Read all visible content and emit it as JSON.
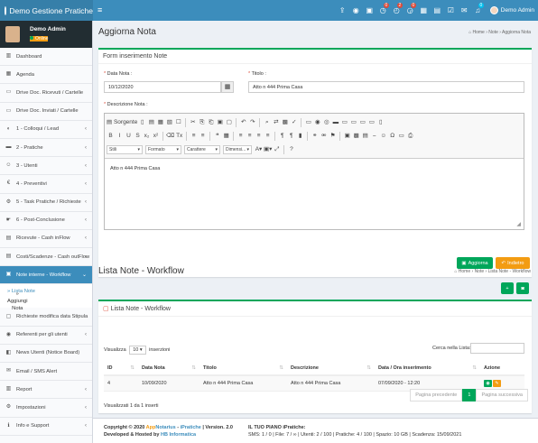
{
  "app": {
    "title": "Demo Gestione Pratiche"
  },
  "topbar": {
    "user_name": "Demo Admin",
    "icons": [
      {
        "name": "upload-icon",
        "glyph": "⇪",
        "badge": ""
      },
      {
        "name": "eye-icon",
        "glyph": "◉",
        "badge": ""
      },
      {
        "name": "warning-icon",
        "glyph": "▣",
        "badge": ""
      },
      {
        "name": "clock-icon",
        "glyph": "◷",
        "badge": "0"
      },
      {
        "name": "alarm-icon",
        "glyph": "◴",
        "badge": "2"
      },
      {
        "name": "stopwatch-icon",
        "glyph": "◶",
        "badge": "0"
      },
      {
        "name": "calendar-icon",
        "glyph": "▦",
        "badge": ""
      },
      {
        "name": "calendar-check-icon",
        "glyph": "▤",
        "badge": ""
      },
      {
        "name": "task-icon",
        "glyph": "☑",
        "badge": ""
      },
      {
        "name": "envelope-icon",
        "glyph": "✉",
        "badge": ""
      },
      {
        "name": "bell-icon",
        "glyph": "♫",
        "badge": "0"
      }
    ]
  },
  "sidebar": {
    "user": {
      "name": "Demo Admin",
      "status": "Online"
    },
    "items": [
      {
        "label": "Dashboard",
        "icon": "▥",
        "caret": ""
      },
      {
        "label": "Agenda",
        "icon": "▦",
        "caret": ""
      },
      {
        "label": "Drive Doc. Ricevuti / Cartelle",
        "icon": "▭",
        "caret": ""
      },
      {
        "label": "Drive Doc. Inviati / Cartelle",
        "icon": "▭",
        "caret": ""
      },
      {
        "label": "1 - Colloqui / Lead",
        "icon": "◐",
        "caret": "‹"
      },
      {
        "label": "2 - Pratiche",
        "icon": "▬",
        "caret": "‹"
      },
      {
        "label": "3 - Utenti",
        "icon": "☺",
        "caret": "‹"
      },
      {
        "label": "4 - Preventivi",
        "icon": "€",
        "caret": "‹"
      },
      {
        "label": "5 - Task Pratiche / Richieste",
        "icon": "⚙",
        "caret": "‹"
      },
      {
        "label": "6 - Post-Conclusione",
        "icon": "☛",
        "caret": "‹"
      },
      {
        "label": "Ricevute - Cash inFlow",
        "icon": "▤",
        "caret": "‹"
      },
      {
        "label": "Costi/Scadenze - Cash outFlow",
        "icon": "▤",
        "caret": "‹"
      },
      {
        "label": "Note interne - Workflow",
        "icon": "▣",
        "caret": "⌄"
      }
    ],
    "subitems": [
      "Lista Note",
      "Aggiungi Nota"
    ],
    "items_after": [
      {
        "label": "Richieste modifica data Stipula",
        "icon": "▢",
        "caret": ""
      },
      {
        "label": "Referenti per gli utenti",
        "icon": "◉",
        "caret": "‹"
      },
      {
        "label": "News Utenti (Notice Board)",
        "icon": "◧",
        "caret": ""
      },
      {
        "label": "Email / SMS Alert",
        "icon": "✉",
        "caret": ""
      },
      {
        "label": "Report",
        "icon": "▥",
        "caret": "‹"
      },
      {
        "label": "Impostazioni",
        "icon": "⚙",
        "caret": "‹"
      },
      {
        "label": "Info e Support",
        "icon": "ℹ",
        "caret": "‹"
      }
    ]
  },
  "section1": {
    "title": "Aggiorna Nota",
    "breadcrumb": [
      "Home",
      "Note",
      "Aggiorna Nota"
    ],
    "box_title": "Form inserimento Note",
    "date_label": "Data Nota :",
    "date_value": "10/12/2020",
    "title_label": "Titolo :",
    "title_value": "Atto n 444 Prima Casa",
    "desc_label": "Descrizione Nota :",
    "editor_source": "Sorgente",
    "editor_combos": [
      "Stili",
      "Formato",
      "Carattere",
      "Dimensi..."
    ],
    "editor_text": "Atto n 444 Prima Casa",
    "btn_update": "Aggiorna",
    "btn_back": "Indietro"
  },
  "section2": {
    "title": "Lista Note - Workflow",
    "breadcrumb": [
      "Home",
      "Note",
      "Lista Note - Workflow"
    ],
    "box_title": "Lista Note - Workflow",
    "show_label": "Visualizza",
    "show_value": "10",
    "entries_label": "inserzioni",
    "search_label": "Cerca nella Lista:",
    "columns": [
      "ID",
      "Data Nota",
      "Titolo",
      "Descrizione",
      "Data / Ora inserimento",
      "Azione"
    ],
    "rows": [
      {
        "id": "4",
        "data": "10/09/2020",
        "titolo": "Atto n 444 Prima Casa",
        "descrizione": "Atto n 444 Prima Casa",
        "inserimento": "07/09/2020 - 12:20"
      }
    ],
    "info": "Visualizzati 1 da 1 inserti",
    "pager": {
      "prev": "Pagina precedente",
      "current": "1",
      "next": "Pagina successiva"
    }
  },
  "footer": {
    "copyright_a": "Copyright © 2020",
    "copyright_brand1": "App",
    "copyright_brand2": "Notarius",
    "copyright_sep": " - ",
    "copyright_brand3": "iPratiche",
    "copyright_b": " | Version. 2.0",
    "developed": "Developed & Hosted by",
    "developer": "HB Informatica",
    "plan": "IL TUO PIANO iPratiche:",
    "stats": "SMS: 1 / 0 | File: 7 / ∞ | Utenti: 2 / 100 | Pratiche: 4 / 100 | Spazio: 10 GB | Scadenza: 15/09/2021"
  },
  "colors": {
    "primary": "#3c8dbc",
    "success": "#00a65a",
    "warning": "#f39c12",
    "danger": "#dd4b39"
  }
}
